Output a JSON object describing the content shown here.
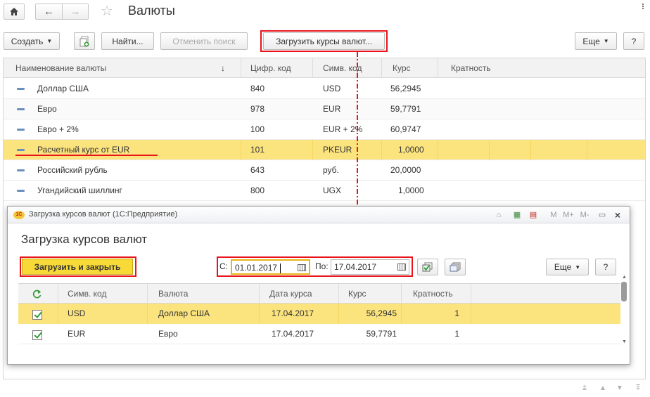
{
  "window": {
    "title": "Валюты",
    "nav": {
      "home": "⌂",
      "back": "←",
      "forward": "→",
      "star": "☆"
    }
  },
  "toolbar": {
    "create_label": "Создать",
    "find_label": "Найти...",
    "cancel_search_label": "Отменить поиск",
    "load_rates_label": "Загрузить курсы валют...",
    "more_label": "Еще"
  },
  "table": {
    "columns": [
      "Наименование валюты",
      "Цифр. код",
      "Симв. код",
      "Курс",
      "Кратность"
    ],
    "sort_indicator": "↓",
    "rows": [
      {
        "name": "Доллар США",
        "num_code": "840",
        "sym_code": "USD",
        "rate": "56,2945"
      },
      {
        "name": "Евро",
        "num_code": "978",
        "sym_code": "EUR",
        "rate": "59,7791"
      },
      {
        "name": "Евро + 2%",
        "num_code": "100",
        "sym_code": "EUR + 2%",
        "rate": "60,9747"
      },
      {
        "name": "Расчетный курс от EUR",
        "num_code": "101",
        "sym_code": "PKEUR",
        "rate": "1,0000"
      },
      {
        "name": "Российский рубль",
        "num_code": "643",
        "sym_code": "руб.",
        "rate": "20,0000"
      },
      {
        "name": "Угандийский шиллинг",
        "num_code": "800",
        "sym_code": "UGX",
        "rate": "1,0000"
      }
    ]
  },
  "dialog": {
    "window_title": "Загрузка курсов валют  (1С:Предприятие)",
    "heading": "Загрузка курсов валют",
    "load_and_close_label": "Загрузить и закрыть",
    "from_label": "С:",
    "from_value": "01.01.2017",
    "to_label": "По:",
    "to_value": "17.04.2017",
    "more_label": "Еще",
    "help_label": "?",
    "titlebar_icons": [
      "M",
      "M+",
      "M-"
    ],
    "columns": [
      "Симв. код",
      "Валюта",
      "Дата курса",
      "Курс",
      "Кратность"
    ],
    "rows": [
      {
        "checked": true,
        "sym_code": "USD",
        "currency": "Доллар США",
        "date": "17.04.2017",
        "rate": "56,2945",
        "multiplicity": "1"
      },
      {
        "checked": true,
        "sym_code": "EUR",
        "currency": "Евро",
        "date": "17.04.2017",
        "rate": "59,7791",
        "multiplicity": "1"
      }
    ]
  },
  "colors": {
    "highlight_red": "#e8141b",
    "selected_row": "#fbe37e",
    "load_button_bg": "#f7d937"
  }
}
